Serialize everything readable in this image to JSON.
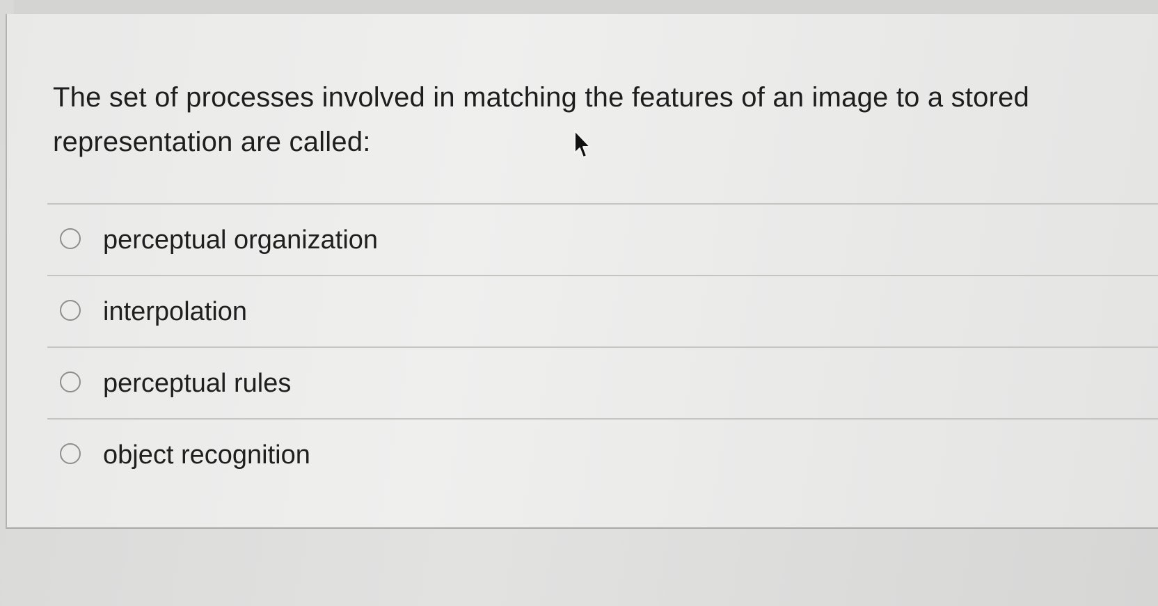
{
  "question": {
    "text": "The set of processes involved in matching the features of an image to a stored representation are called:"
  },
  "choices": [
    {
      "label": "perceptual organization",
      "selected": false
    },
    {
      "label": "interpolation",
      "selected": false
    },
    {
      "label": "perceptual rules",
      "selected": false
    },
    {
      "label": "object recognition",
      "selected": false
    }
  ],
  "icons": {
    "radio": "radio-unselected-icon",
    "cursor": "mouse-pointer-icon"
  },
  "colors": {
    "card_background": "#ececeb",
    "text": "#1f1f1f",
    "divider": "#c4c4c3",
    "radio_border": "#8e8e8d"
  }
}
